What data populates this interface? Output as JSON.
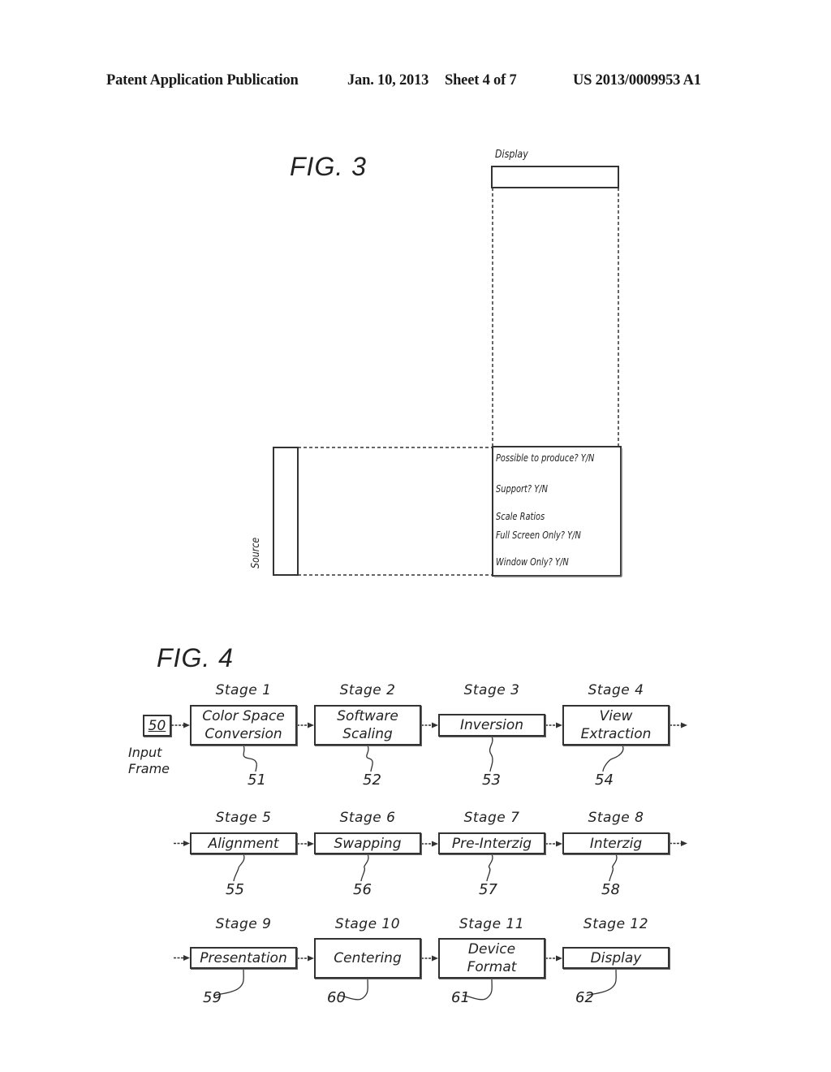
{
  "header": {
    "publication": "Patent Application Publication",
    "date": "Jan. 10, 2013",
    "sheet": "Sheet 4 of 7",
    "number": "US 2013/0009953 A1"
  },
  "fig3": {
    "title": "FIG. 3",
    "display_label": "Display",
    "source_label": "Source",
    "options": [
      "Possible to produce? Y/N",
      "Support? Y/N",
      "Scale Ratios",
      "Full Screen Only? Y/N",
      "Window Only? Y/N"
    ]
  },
  "fig4": {
    "title": "FIG. 4",
    "input": {
      "ref": "50",
      "label_line1": "Input",
      "label_line2": "Frame"
    },
    "stages": [
      {
        "stage": "Stage 1",
        "lines": [
          "Color Space",
          "Conversion"
        ],
        "ref": "51"
      },
      {
        "stage": "Stage 2",
        "lines": [
          "Software",
          "Scaling"
        ],
        "ref": "52"
      },
      {
        "stage": "Stage 3",
        "lines": [
          "Inversion"
        ],
        "ref": "53"
      },
      {
        "stage": "Stage 4",
        "lines": [
          "View",
          "Extraction"
        ],
        "ref": "54"
      },
      {
        "stage": "Stage 5",
        "lines": [
          "Alignment"
        ],
        "ref": "55"
      },
      {
        "stage": "Stage 6",
        "lines": [
          "Swapping"
        ],
        "ref": "56"
      },
      {
        "stage": "Stage 7",
        "lines": [
          "Pre-Interzig"
        ],
        "ref": "57"
      },
      {
        "stage": "Stage 8",
        "lines": [
          "Interzig"
        ],
        "ref": "58"
      },
      {
        "stage": "Stage 9",
        "lines": [
          "Presentation"
        ],
        "ref": "59"
      },
      {
        "stage": "Stage 10",
        "lines": [
          "Centering"
        ],
        "ref": "60"
      },
      {
        "stage": "Stage 11",
        "lines": [
          "Device",
          "Format"
        ],
        "ref": "61"
      },
      {
        "stage": "Stage 12",
        "lines": [
          "Display"
        ],
        "ref": "62"
      }
    ]
  }
}
